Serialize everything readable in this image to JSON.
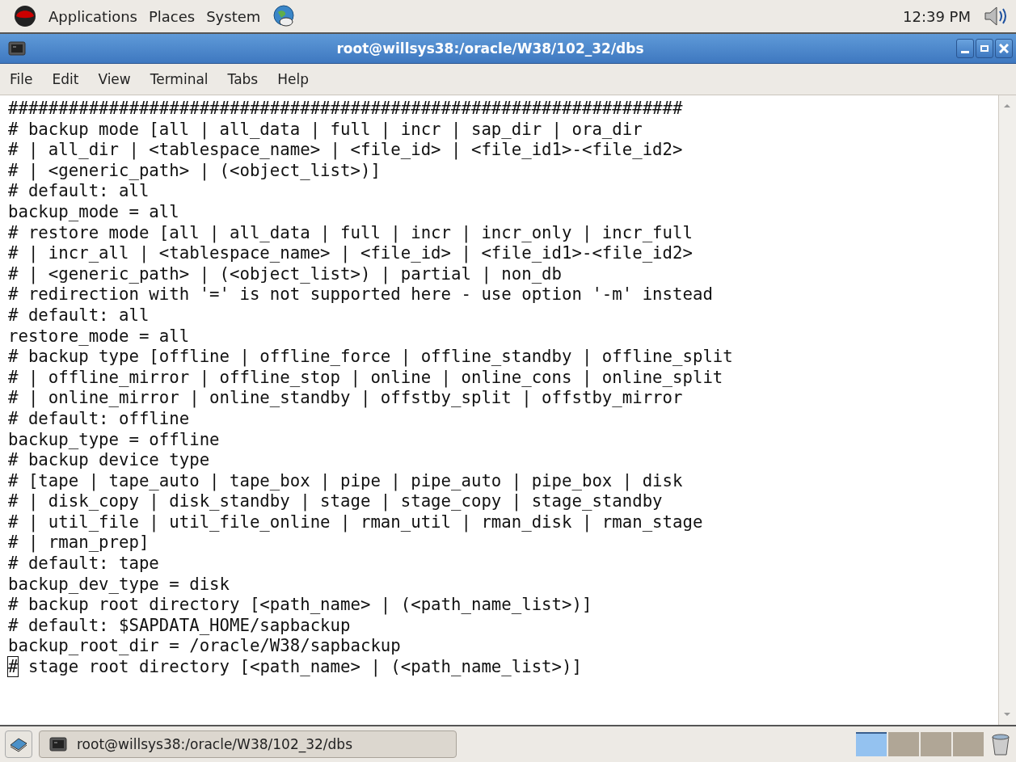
{
  "top_panel": {
    "menus": [
      "Applications",
      "Places",
      "System"
    ],
    "clock": "12:39 PM"
  },
  "window": {
    "title": "root@willsys38:/oracle/W38/102_32/dbs"
  },
  "menu_bar": [
    "File",
    "Edit",
    "View",
    "Terminal",
    "Tabs",
    "Help"
  ],
  "terminal": {
    "lines": [
      {
        "text": "###################################################################",
        "cursor": false
      },
      {
        "text": "# backup mode [all | all_data | full | incr | sap_dir | ora_dir",
        "cursor": false
      },
      {
        "text": "# | all_dir | <tablespace_name> | <file_id> | <file_id1>-<file_id2>",
        "cursor": false
      },
      {
        "text": "# | <generic_path> | (<object_list>)]",
        "cursor": false
      },
      {
        "text": "# default: all",
        "cursor": false
      },
      {
        "text": "backup_mode = all",
        "cursor": false
      },
      {
        "text": "# restore mode [all | all_data | full | incr | incr_only | incr_full",
        "cursor": false
      },
      {
        "text": "# | incr_all | <tablespace_name> | <file_id> | <file_id1>-<file_id2>",
        "cursor": false
      },
      {
        "text": "# | <generic_path> | (<object_list>) | partial | non_db",
        "cursor": false
      },
      {
        "text": "# redirection with '=' is not supported here - use option '-m' instead",
        "cursor": false
      },
      {
        "text": "# default: all",
        "cursor": false
      },
      {
        "text": "restore_mode = all",
        "cursor": false
      },
      {
        "text": "# backup type [offline | offline_force | offline_standby | offline_split",
        "cursor": false
      },
      {
        "text": "# | offline_mirror | offline_stop | online | online_cons | online_split",
        "cursor": false
      },
      {
        "text": "# | online_mirror | online_standby | offstby_split | offstby_mirror",
        "cursor": false
      },
      {
        "text": "# default: offline",
        "cursor": false
      },
      {
        "text": "backup_type = offline",
        "cursor": false
      },
      {
        "text": "# backup device type",
        "cursor": false
      },
      {
        "text": "# [tape | tape_auto | tape_box | pipe | pipe_auto | pipe_box | disk",
        "cursor": false
      },
      {
        "text": "# | disk_copy | disk_standby | stage | stage_copy | stage_standby",
        "cursor": false
      },
      {
        "text": "# | util_file | util_file_online | rman_util | rman_disk | rman_stage",
        "cursor": false
      },
      {
        "text": "# | rman_prep]",
        "cursor": false
      },
      {
        "text": "# default: tape",
        "cursor": false
      },
      {
        "text": "backup_dev_type = disk",
        "cursor": false
      },
      {
        "text": "# backup root directory [<path_name> | (<path_name_list>)]",
        "cursor": false
      },
      {
        "text": "# default: $SAPDATA_HOME/sapbackup",
        "cursor": false
      },
      {
        "text": "backup_root_dir = /oracle/W38/sapbackup",
        "cursor": false
      },
      {
        "text": "# stage root directory [<path_name> | (<path_name_list>)]",
        "cursor": true
      }
    ]
  },
  "taskbar": {
    "task": "root@willsys38:/oracle/W38/102_32/dbs",
    "workspaces": [
      {
        "selected": true
      },
      {
        "selected": false
      },
      {
        "selected": false
      },
      {
        "selected": false
      }
    ]
  }
}
